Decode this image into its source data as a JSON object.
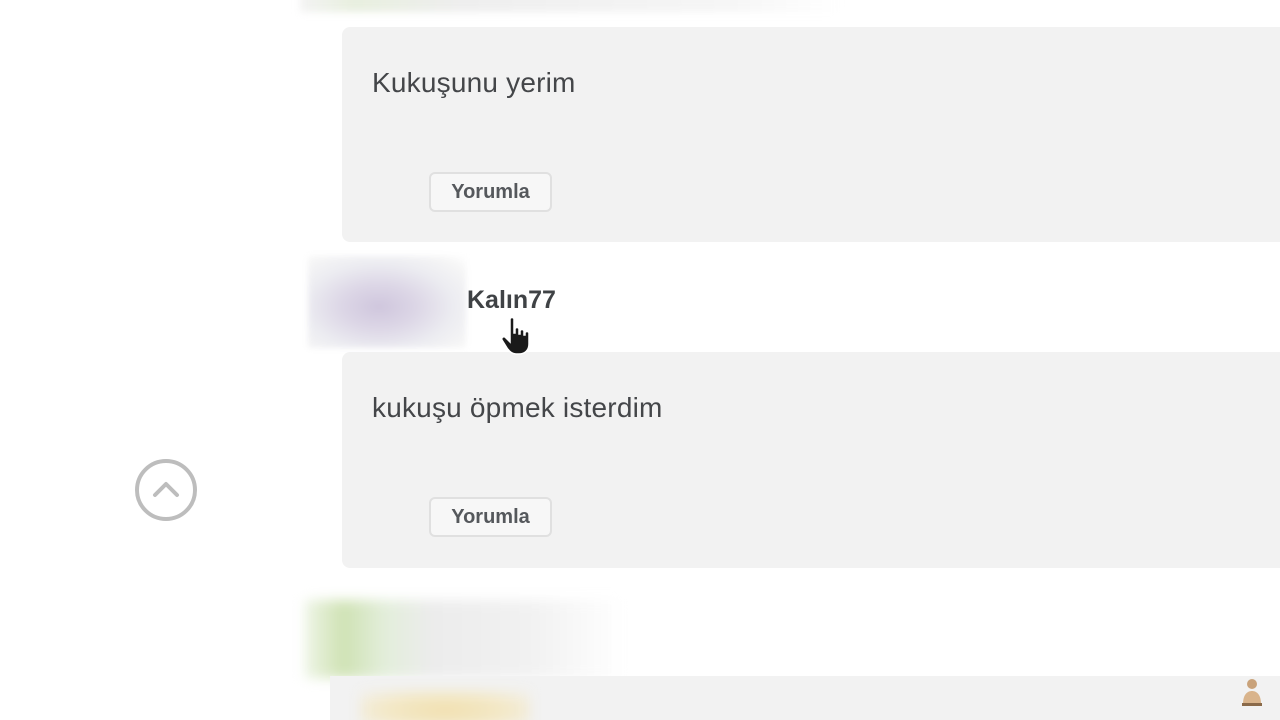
{
  "comments": [
    {
      "text": "Kukuşunu yerim",
      "reply_label": "Yorumla"
    },
    {
      "author": "Kalın77",
      "text": "kukuşu öpmek isterdim",
      "reply_label": "Yorumla"
    }
  ],
  "icons": {
    "scroll_top": "chevron-up-circle-icon",
    "cursor": "hand-pointer-icon",
    "corner": "person-icon"
  },
  "colors": {
    "card_background": "#f2f2f2",
    "text": "#444649",
    "button_border": "#e0e0e0",
    "scroll_button_border": "#bdbdbd"
  }
}
